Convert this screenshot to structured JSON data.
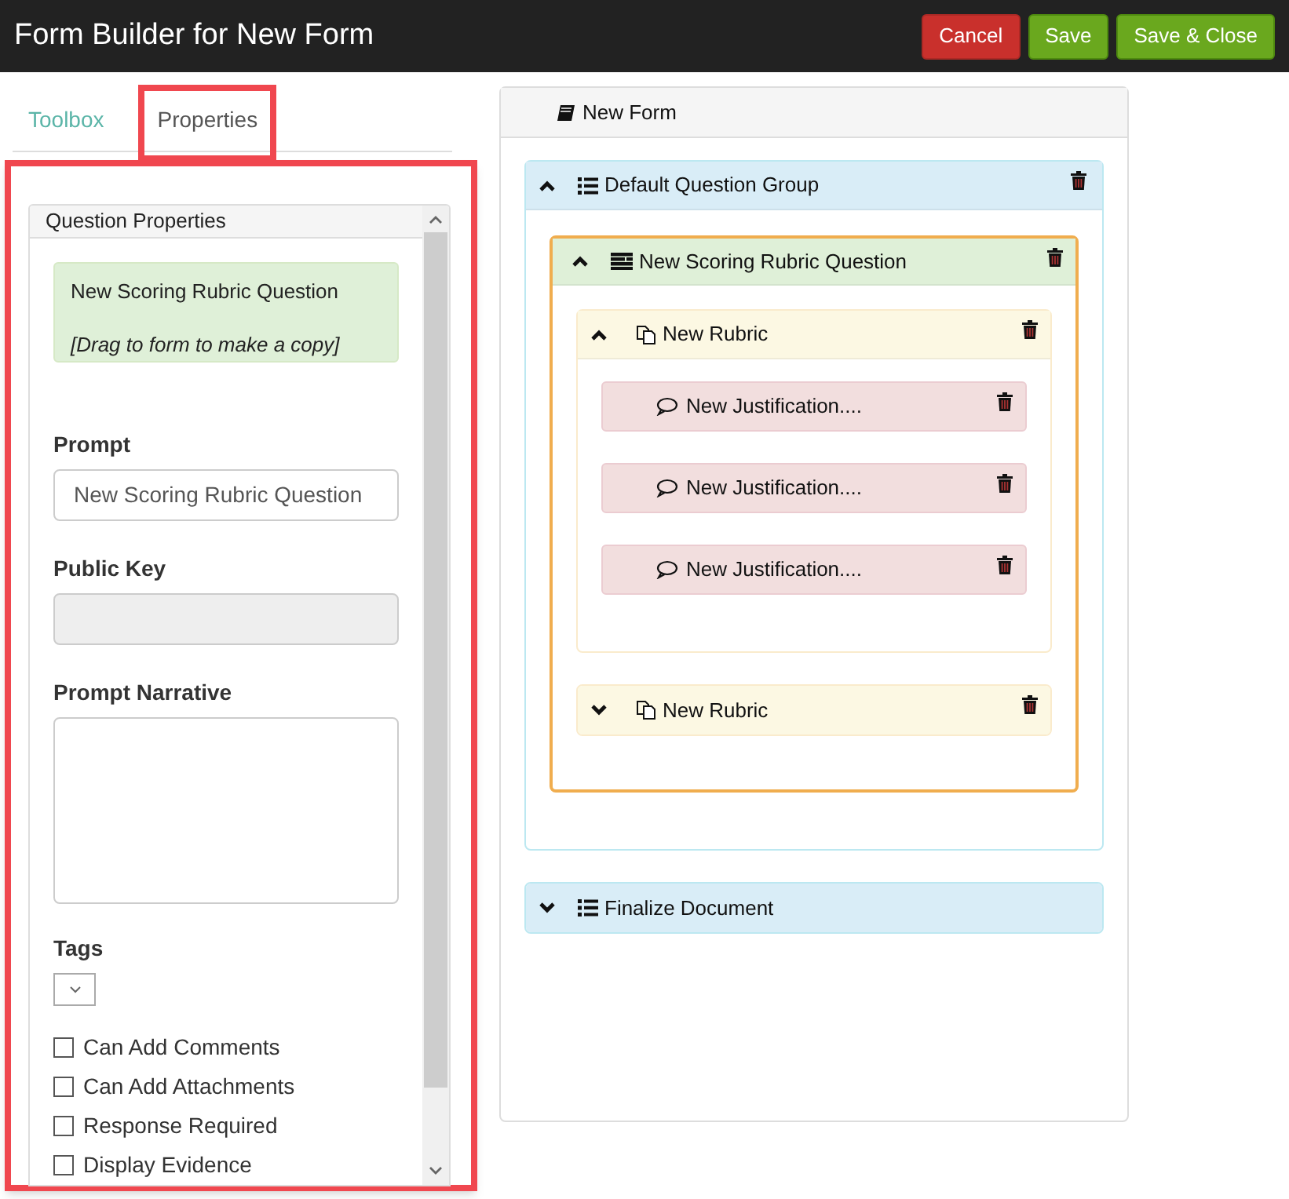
{
  "header": {
    "title": "Form Builder for New Form",
    "buttons": [
      {
        "label": "Cancel",
        "kind": "danger"
      },
      {
        "label": "Save",
        "kind": "success"
      },
      {
        "label": "Save & Close",
        "kind": "success"
      }
    ]
  },
  "tabs": [
    {
      "label": "Toolbox",
      "selected": false,
      "highlighted": false
    },
    {
      "label": "Properties",
      "selected": true,
      "highlighted": true
    }
  ],
  "properties": {
    "highlighted": true,
    "title": "Question Properties",
    "drag_item": {
      "label": "New Scoring Rubric Question",
      "hint": "[Drag to form to make a copy]"
    },
    "fields": [
      {
        "kind": "input",
        "label": "Prompt",
        "value": "New Scoring Rubric Question",
        "disabled": false
      },
      {
        "kind": "input",
        "label": "Public Key",
        "disabled": true
      },
      {
        "kind": "textarea",
        "label": "Prompt Narrative"
      },
      {
        "kind": "select",
        "label": "Tags"
      }
    ],
    "options": [
      {
        "label": "Can Add Comments",
        "checked": false
      },
      {
        "label": "Can Add Attachments",
        "checked": false
      },
      {
        "label": "Response Required",
        "checked": false
      },
      {
        "label": "Display Evidence",
        "checked": false
      }
    ]
  },
  "form": {
    "title": "New Form",
    "items": [
      {
        "kind": "group",
        "title": "Default Question Group",
        "expanded": true,
        "children": [
          {
            "kind": "question",
            "title": "New Scoring Rubric Question",
            "expanded": true,
            "selected": true,
            "children": [
              {
                "kind": "rubric",
                "title": "New Rubric",
                "expanded": true,
                "children": [
                  {
                    "kind": "justification",
                    "title": "New Justification...."
                  },
                  {
                    "kind": "justification",
                    "title": "New Justification...."
                  },
                  {
                    "kind": "justification",
                    "title": "New Justification...."
                  }
                ]
              },
              {
                "kind": "rubric",
                "title": "New Rubric",
                "expanded": false
              }
            ]
          }
        ]
      },
      {
        "kind": "group",
        "title": "Finalize Document",
        "expanded": false
      }
    ]
  }
}
